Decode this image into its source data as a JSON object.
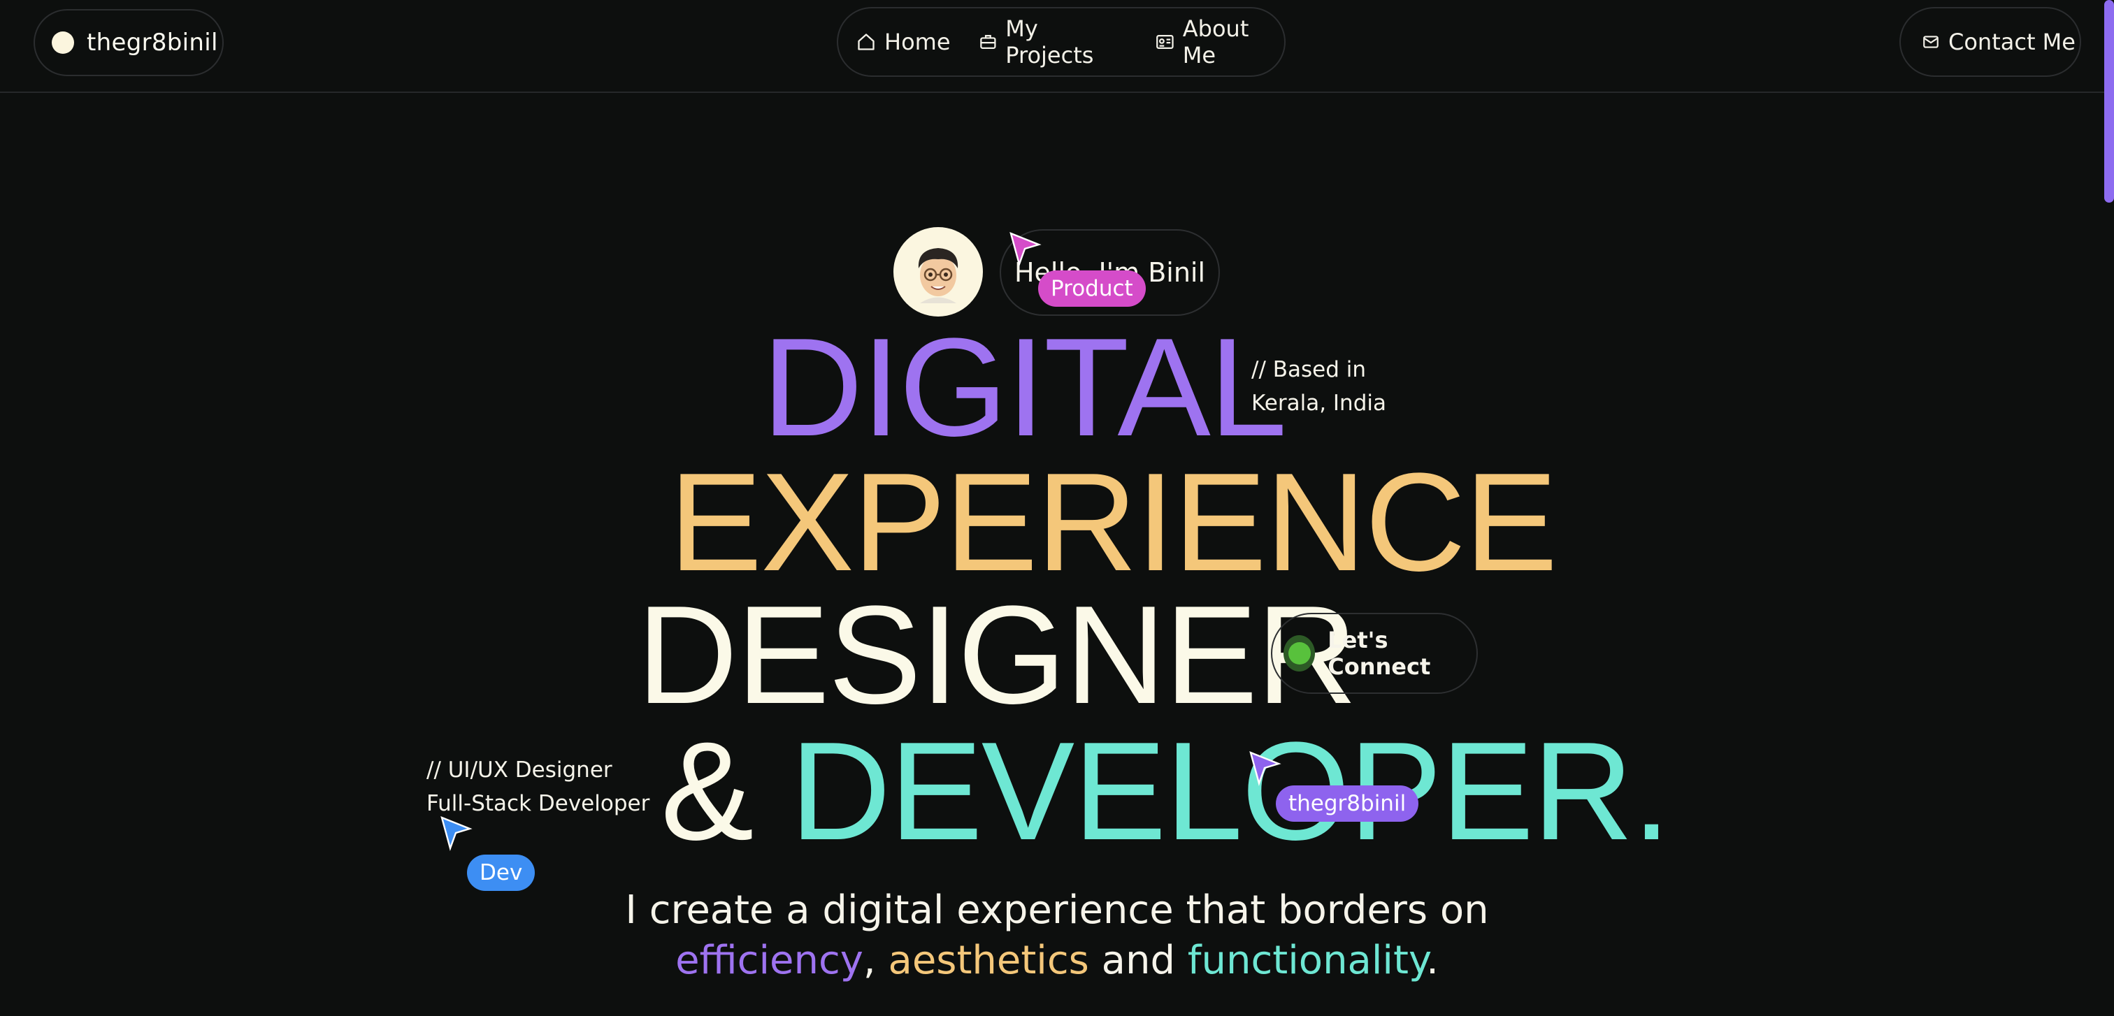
{
  "nav": {
    "brand": "thegr8binil",
    "items": [
      {
        "label": "Home",
        "icon": "home-icon"
      },
      {
        "label": "My Projects",
        "icon": "briefcase-icon"
      },
      {
        "label": "About Me",
        "icon": "id-card-icon"
      }
    ],
    "contact": {
      "label": "Contact Me",
      "icon": "mail-icon"
    }
  },
  "hero": {
    "greeting": "Hello, I'm Binil",
    "line1": "DIGITAL",
    "line2": "EXPERIENCE",
    "line3": "DESIGNER",
    "amp": "&",
    "line4": "DEVELOPER.",
    "based_line1": "// Based in",
    "based_line2": "Kerala, India",
    "roles_line1": "// UI/UX Designer",
    "roles_line2": "Full-Stack Developer",
    "connect_label": "Let's Connect"
  },
  "cursors": {
    "product": "Product",
    "binil": "thegr8binil",
    "dev": "Dev"
  },
  "tagline": {
    "line1": "I create a digital experience that borders on",
    "word1": "efficiency",
    "sep1": ", ",
    "word2": "aesthetics",
    "sep2": " and ",
    "word3": "functionality",
    "end": "."
  },
  "colors": {
    "background": "#0d0f0e",
    "purple": "#9e73f0",
    "yellow": "#f4c77a",
    "cream": "#fbf9e8",
    "teal": "#6ee7d3",
    "product_tag": "#d54cc9",
    "dev_tag": "#3d8ef3",
    "status_green": "#58c13c"
  }
}
